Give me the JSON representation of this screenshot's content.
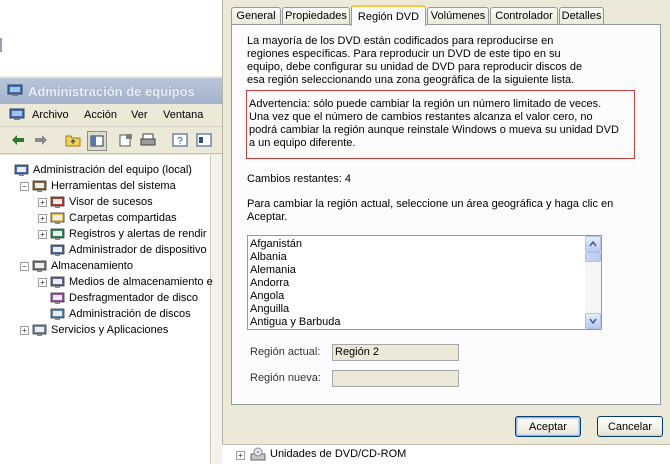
{
  "mmc": {
    "title": "Administración de equipos",
    "menu": [
      "Archivo",
      "Acción",
      "Ver",
      "Ventana"
    ],
    "tree": [
      {
        "label": "Administración del equipo (local)",
        "level": 0,
        "expander": "",
        "icon": "computer-icon"
      },
      {
        "label": "Herramientas del sistema",
        "level": 1,
        "expander": "−",
        "icon": "tools-icon"
      },
      {
        "label": "Visor de sucesos",
        "level": 2,
        "expander": "+",
        "icon": "event-viewer-icon"
      },
      {
        "label": "Carpetas compartidas",
        "level": 2,
        "expander": "+",
        "icon": "shared-folder-icon"
      },
      {
        "label": "Registros y alertas de rendir",
        "level": 2,
        "expander": "+",
        "icon": "performance-log-icon"
      },
      {
        "label": "Administrador de dispositivo",
        "level": 2,
        "expander": "",
        "icon": "device-manager-icon"
      },
      {
        "label": "Almacenamiento",
        "level": 1,
        "expander": "−",
        "icon": "storage-icon"
      },
      {
        "label": "Medios de almacenamiento e",
        "level": 2,
        "expander": "+",
        "icon": "removable-storage-icon"
      },
      {
        "label": "Desfragmentador de disco",
        "level": 2,
        "expander": "",
        "icon": "defrag-icon"
      },
      {
        "label": "Administración de discos",
        "level": 2,
        "expander": "",
        "icon": "disk-management-icon"
      },
      {
        "label": "Servicios y Aplicaciones",
        "level": 1,
        "expander": "+",
        "icon": "services-icon"
      }
    ]
  },
  "dialog": {
    "tabs": [
      "General",
      "Propiedades",
      "Región DVD",
      "Volúmenes",
      "Controlador",
      "Detalles"
    ],
    "active_tab": "Región DVD",
    "intro_lines": [
      "La mayoría de los DVD están codificados para reproducirse en",
      "regiones específicas. Para reproducir un DVD de este tipo en su",
      "equipo, debe configurar su unidad de DVD para reproducir discos de",
      "esa región seleccionando una zona geográfica de la siguiente lista."
    ],
    "warning_lines": [
      "Advertencia: sólo puede cambiar la región un número limitado de veces.",
      "Una vez que el número de cambios restantes alcanza el valor cero, no",
      "podrá cambiar la región aunque reinstale Windows o mueva su unidad DVD",
      "a un equipo diferente."
    ],
    "changes_remaining": "Cambios restantes: 4",
    "instruction_lines": [
      "Para cambiar la región actual, seleccione un área geográfica y haga clic en",
      "Aceptar."
    ],
    "countries": [
      "Afganistán",
      "Albania",
      "Alemania",
      "Andorra",
      "Angola",
      "Anguilla",
      "Antigua y Barbuda"
    ],
    "current_region_label": "Región actual:",
    "current_region_value": "Región 2",
    "new_region_label": "Región nueva:",
    "new_region_value": "",
    "ok_label": "Aceptar",
    "cancel_label": "Cancelar"
  },
  "bottom": {
    "item_label": "Unidades de DVD/CD-ROM"
  }
}
